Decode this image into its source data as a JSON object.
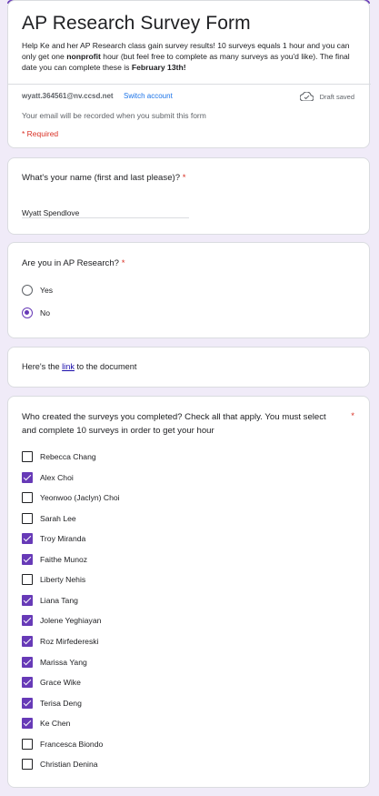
{
  "form": {
    "title": "AP Research Survey Form",
    "desc_part1": "Help Ke and her AP Research class gain survey results! 10 surveys equals 1 hour and you can only get one ",
    "desc_bold1": "nonprofit",
    "desc_part2": " hour (but feel free to complete as many surveys as you'd like). The final date you can complete these is ",
    "desc_bold2": "February 13th!",
    "email": "wyatt.364561@nv.ccsd.net",
    "switch_account": "Switch account",
    "draft_status": "Draft saved",
    "email_note": "Your email will be recorded when you submit this form",
    "required_note": "* Required"
  },
  "q_name": {
    "title": "What's your name (first and last please)?",
    "star": "*",
    "value": "Wyatt Spendlove"
  },
  "q_research": {
    "title": "Are you in AP Research?",
    "star": "*",
    "options": [
      {
        "label": "Yes",
        "checked": false
      },
      {
        "label": "No",
        "checked": true
      }
    ]
  },
  "link_section": {
    "prefix": "Here's the ",
    "link": "link",
    "suffix": " to the document"
  },
  "q_surveys": {
    "title": "Who created the surveys you completed? Check all that apply. You must select and complete 10 surveys in order to get your hour",
    "star": "*",
    "options": [
      {
        "label": "Rebecca Chang",
        "checked": false
      },
      {
        "label": "Alex Choi",
        "checked": true
      },
      {
        "label": "Yeonwoo (Jaclyn) Choi",
        "checked": false
      },
      {
        "label": "Sarah Lee",
        "checked": false
      },
      {
        "label": "Troy Miranda",
        "checked": true
      },
      {
        "label": "Faithe Munoz",
        "checked": true
      },
      {
        "label": "Liberty Nehis",
        "checked": false
      },
      {
        "label": "Liana Tang",
        "checked": true
      },
      {
        "label": "Jolene Yeghiayan",
        "checked": true
      },
      {
        "label": "Roz Mirfedereski",
        "checked": true
      },
      {
        "label": "Marissa Yang",
        "checked": true
      },
      {
        "label": "Grace Wike",
        "checked": true
      },
      {
        "label": "Terisa Deng",
        "checked": true
      },
      {
        "label": "Ke Chen",
        "checked": true
      },
      {
        "label": "Francesca Biondo",
        "checked": false
      },
      {
        "label": "Christian Denina",
        "checked": false
      }
    ]
  },
  "colors": {
    "accent": "#673ab7",
    "background": "#f0ebf8",
    "required": "#d93025",
    "link": "#1a73e8"
  }
}
